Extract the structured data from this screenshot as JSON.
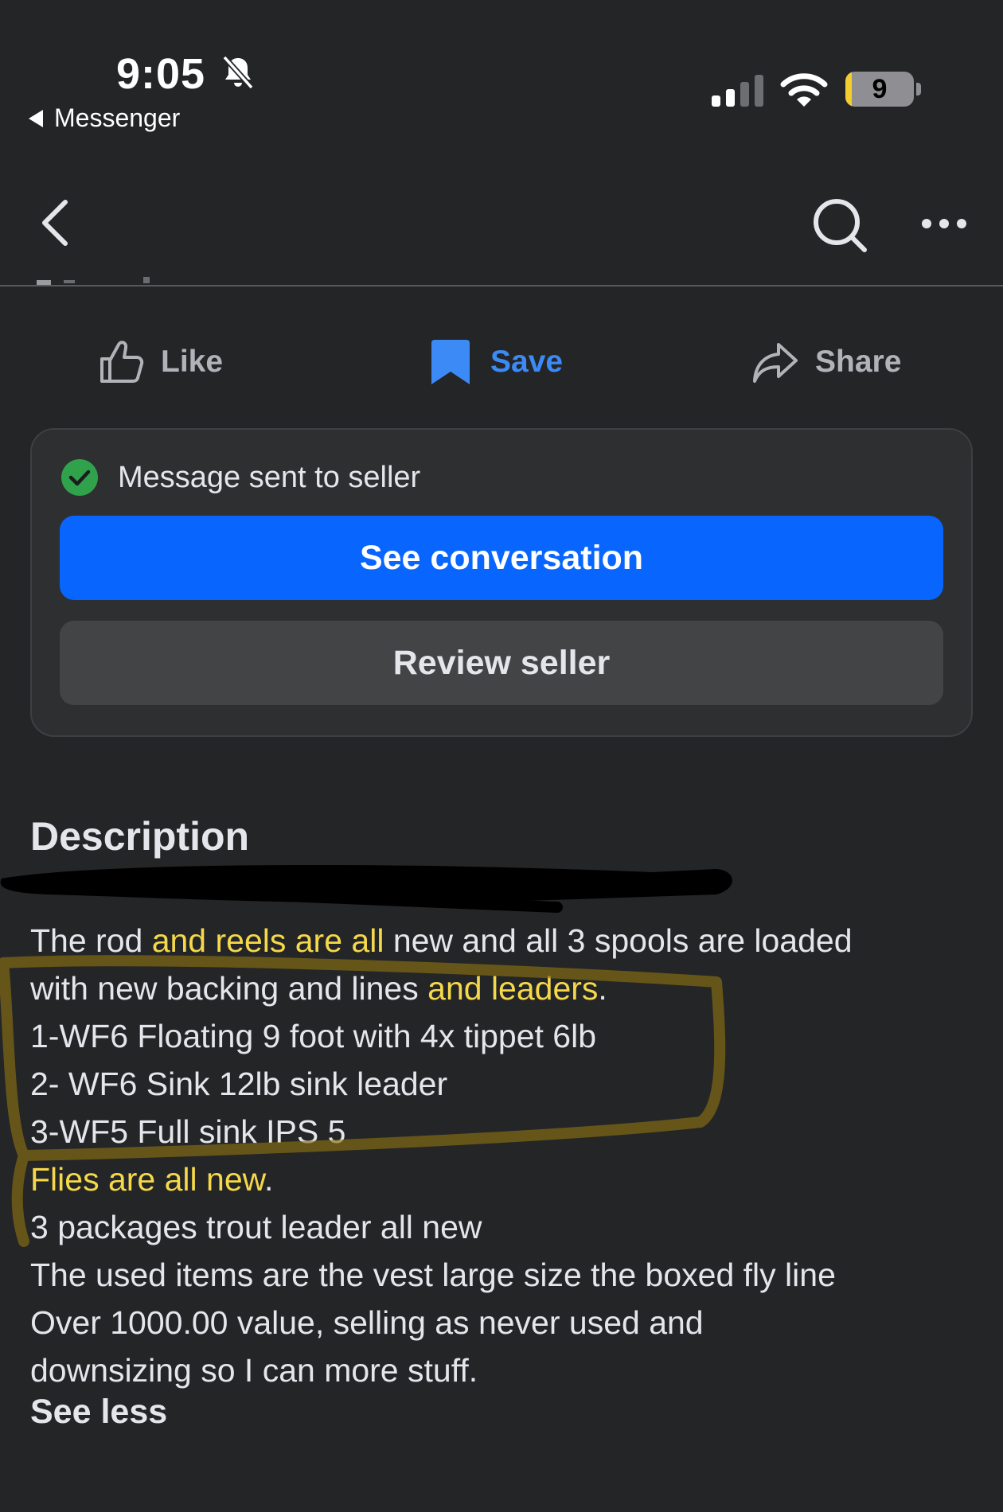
{
  "status_bar": {
    "time": "9:05",
    "back_app": "Messenger",
    "battery_level": "9",
    "battery_fraction": 0.09
  },
  "nav": {
    "back_icon": "chevron-left-icon",
    "search_icon": "search-icon",
    "more_icon": "more-icon"
  },
  "actions": {
    "like": "Like",
    "save": "Save",
    "share": "Share"
  },
  "message_card": {
    "status": "Message sent to seller",
    "see_conversation": "See conversation",
    "review_seller": "Review seller"
  },
  "description": {
    "title": "Description",
    "lines": [
      [
        {
          "t": "The rod "
        },
        {
          "t": "and reels are all",
          "hl": true
        },
        {
          "t": " new and all 3 spools are loaded"
        }
      ],
      [
        {
          "t": "with new backing and lines "
        },
        {
          "t": "and leaders",
          "hl": true
        },
        {
          "t": "."
        }
      ],
      [
        {
          "t": "1-WF6 Floating 9 foot with 4x tippet 6lb"
        }
      ],
      [
        {
          "t": "2- WF6 Sink 12lb sink leader"
        }
      ],
      [
        {
          "t": "3-WF5 Full sink IPS 5"
        }
      ],
      [
        {
          "t": "Flies are all new",
          "hl": true
        },
        {
          "t": "."
        }
      ],
      [
        {
          "t": "3 packages trout leader all new"
        }
      ],
      [
        {
          "t": "The used items are the vest large size the boxed fly line"
        }
      ],
      [
        {
          "t": "Over 1000.00 value, selling as never used and"
        }
      ],
      [
        {
          "t": "downsizing so I can more stuff."
        }
      ]
    ],
    "see_less": "See less"
  },
  "colors": {
    "background": "#242527",
    "primary_button": "#0866ff",
    "save_accent": "#3b8af6",
    "highlight_text": "#f5d94a",
    "marker_annotation": "#8a6f12",
    "check_green": "#31a24c"
  }
}
